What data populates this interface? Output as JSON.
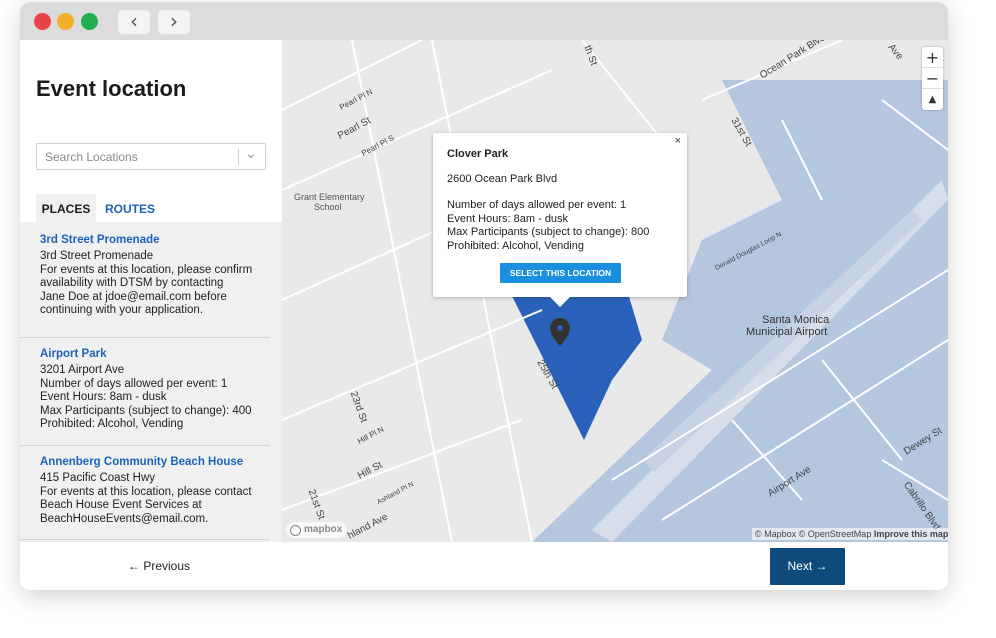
{
  "browser": {
    "back_icon": "‹",
    "forward_icon": "›"
  },
  "sidebar": {
    "title": "Event location",
    "search_placeholder": "Search Locations",
    "tabs": [
      {
        "label": "PLACES"
      },
      {
        "label": "ROUTES"
      }
    ],
    "places": [
      {
        "name": "3rd Street Promenade",
        "lines": [
          "3rd Street Promenade",
          "For events at this location, please confirm",
          "availability with DTSM by contacting",
          "Jane Doe at jdoe@email.com before",
          "continuing with your application."
        ]
      },
      {
        "name": "Airport Park",
        "lines": [
          "3201 Airport Ave",
          "Number of days allowed per event: 1",
          "Event Hours: 8am - dusk",
          "Max Participants (subject to change): 400",
          "Prohibited: Alcohol, Vending"
        ]
      },
      {
        "name": "Annenberg Community Beach House",
        "lines": [
          "415 Pacific Coast Hwy",
          "For events at this location, please contact",
          "Beach House Event Services at",
          "BeachHouseEvents@email.com."
        ]
      }
    ]
  },
  "map": {
    "zoom_in": "+",
    "zoom_out": "−",
    "compass": "▲",
    "labels": {
      "school": "Grant Elementary",
      "school2": "School",
      "airport": "Santa Monica",
      "airport2": "Municipal Airport"
    },
    "streets": {
      "pearl_pl_n": "Pearl Pl N",
      "pearl_st": "Pearl St",
      "pearl_pl_s": "Pearl Pl S",
      "s20th": "th St",
      "ocean_park": "Ocean Park Blvd",
      "s31st": "31st St",
      "ave_top": "Ave",
      "donald": "Donald Douglas Loop N",
      "s25th": "25th St",
      "s23rd": "23rd St",
      "hill_pl_n": "Hill Pl N",
      "hill_st": "Hill St",
      "ashland_pl_n": "Ashland Pl N",
      "s21st": "21st St",
      "ashland_ave": "hland Ave",
      "airport_ave": "Airport Ave",
      "dewey": "Dewey St",
      "cabrillo": "Cabrillo Blvd"
    },
    "popup": {
      "close": "×",
      "title": "Clover Park",
      "address": "2600 Ocean Park Blvd",
      "details": [
        "Number of days allowed per event: 1",
        "Event Hours: 8am - dusk",
        "Max Participants (subject to change): 800",
        "Prohibited: Alcohol, Vending"
      ],
      "button": "SELECT THIS LOCATION"
    },
    "attribution": "© Mapbox © OpenStreetMap",
    "attribution_link": "Improve this map",
    "logo": "mapbox"
  },
  "footer": {
    "previous": "← Previous",
    "next": "Next →"
  }
}
